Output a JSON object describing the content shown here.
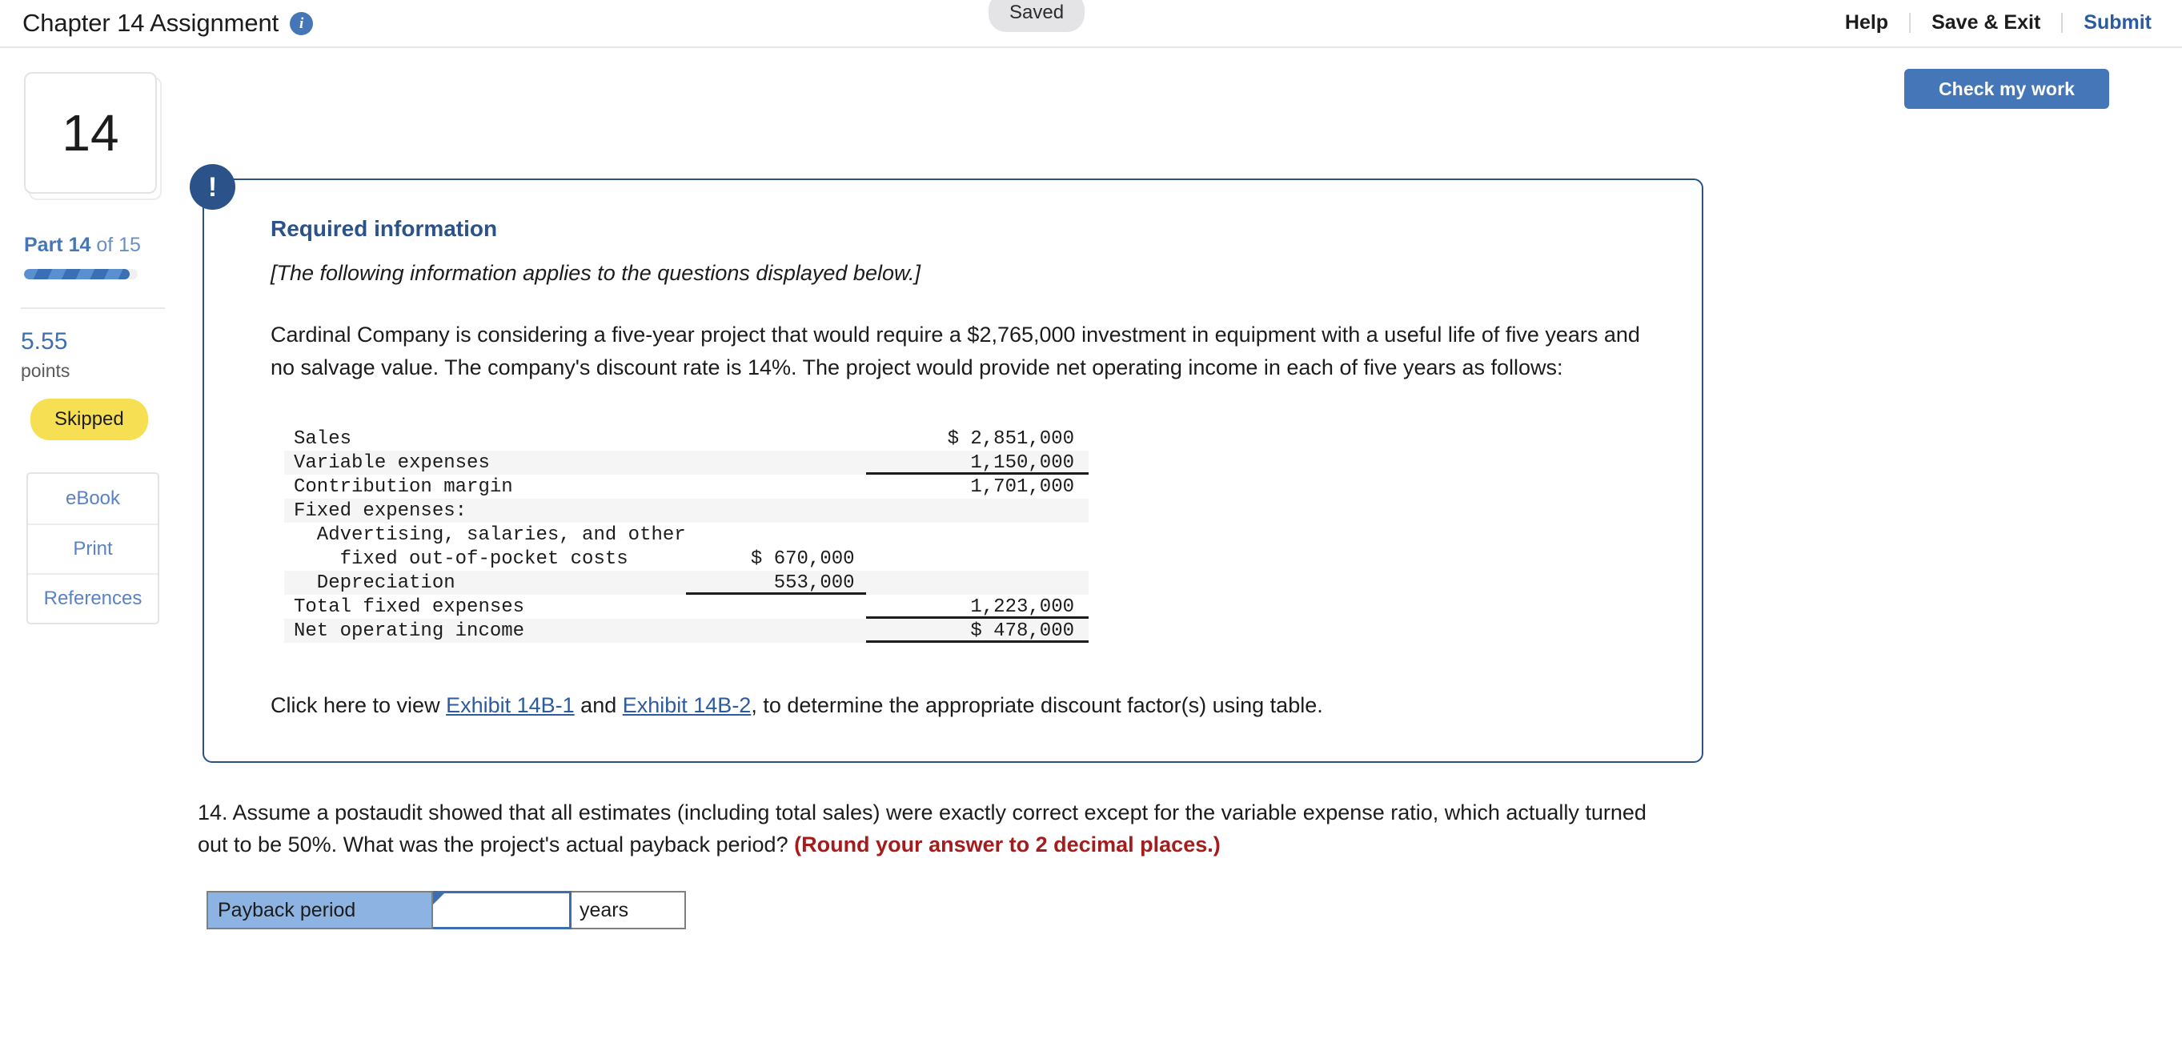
{
  "header": {
    "title": "Chapter 14 Assignment",
    "info_icon": "info-icon",
    "saved_badge": "Saved",
    "help_label": "Help",
    "save_exit_label": "Save & Exit",
    "submit_label": "Submit"
  },
  "toolbar": {
    "check_my_work_label": "Check my work"
  },
  "sidebar": {
    "part_card_number": "14",
    "part_prefix": "Part ",
    "part_number": "14",
    "part_suffix": " of 15",
    "progress_percent": 93,
    "points_value": "5.55",
    "points_label": "points",
    "status_badge": "Skipped",
    "tools": [
      {
        "label": "eBook"
      },
      {
        "label": "Print"
      },
      {
        "label": "References"
      }
    ]
  },
  "required_info": {
    "alert_icon": "exclamation-icon",
    "title": "Required information",
    "subtitle": "[The following information applies to the questions displayed below.]",
    "paragraph": "Cardinal Company is considering a five-year project that would require a $2,765,000 investment in equipment with a useful life of five years and no salvage value. The company's discount rate is 14%. The project would provide net operating income in each of five years as follows:",
    "exhibit_prefix": "Click here to view ",
    "exhibit_link_1": "Exhibit 14B-1",
    "exhibit_conjunction": " and ",
    "exhibit_link_2": "Exhibit 14B-2",
    "exhibit_suffix": ", to determine the appropriate discount factor(s) using table."
  },
  "income_statement": {
    "rows": [
      {
        "label": "Sales",
        "mid": "",
        "right": "$ 2,851,000",
        "shaded": false,
        "underline_mid": false,
        "underline_right": false
      },
      {
        "label": "Variable expenses",
        "mid": "",
        "right": "1,150,000",
        "shaded": true,
        "underline_mid": false,
        "underline_right": true
      },
      {
        "label": "Contribution margin",
        "mid": "",
        "right": "1,701,000",
        "shaded": false,
        "underline_mid": false,
        "underline_right": false
      },
      {
        "label": "Fixed expenses:",
        "mid": "",
        "right": "",
        "shaded": true,
        "underline_mid": false,
        "underline_right": false
      },
      {
        "label": "  Advertising, salaries, and other",
        "mid": "",
        "right": "",
        "shaded": false,
        "underline_mid": false,
        "underline_right": false
      },
      {
        "label": "    fixed out-of-pocket costs",
        "mid": "$ 670,000",
        "right": "",
        "shaded": false,
        "underline_mid": false,
        "underline_right": false
      },
      {
        "label": "  Depreciation",
        "mid": "553,000",
        "right": "",
        "shaded": true,
        "underline_mid": true,
        "underline_right": false
      },
      {
        "label": "Total fixed expenses",
        "mid": "",
        "right": "1,223,000",
        "shaded": false,
        "underline_mid": false,
        "underline_right": true
      },
      {
        "label": "Net operating income",
        "mid": "",
        "right": "$ 478,000",
        "shaded": true,
        "underline_mid": false,
        "underline_right": true
      }
    ]
  },
  "question": {
    "number_and_text": "14. Assume a postaudit showed that all estimates (including total sales) were exactly correct except for the variable expense ratio, which actually turned out to be 50%. What was the project's actual payback period? ",
    "round_note": "(Round your answer to 2 decimal places.)"
  },
  "answer": {
    "label": "Payback period",
    "value": "",
    "placeholder": "",
    "unit": "years"
  }
}
